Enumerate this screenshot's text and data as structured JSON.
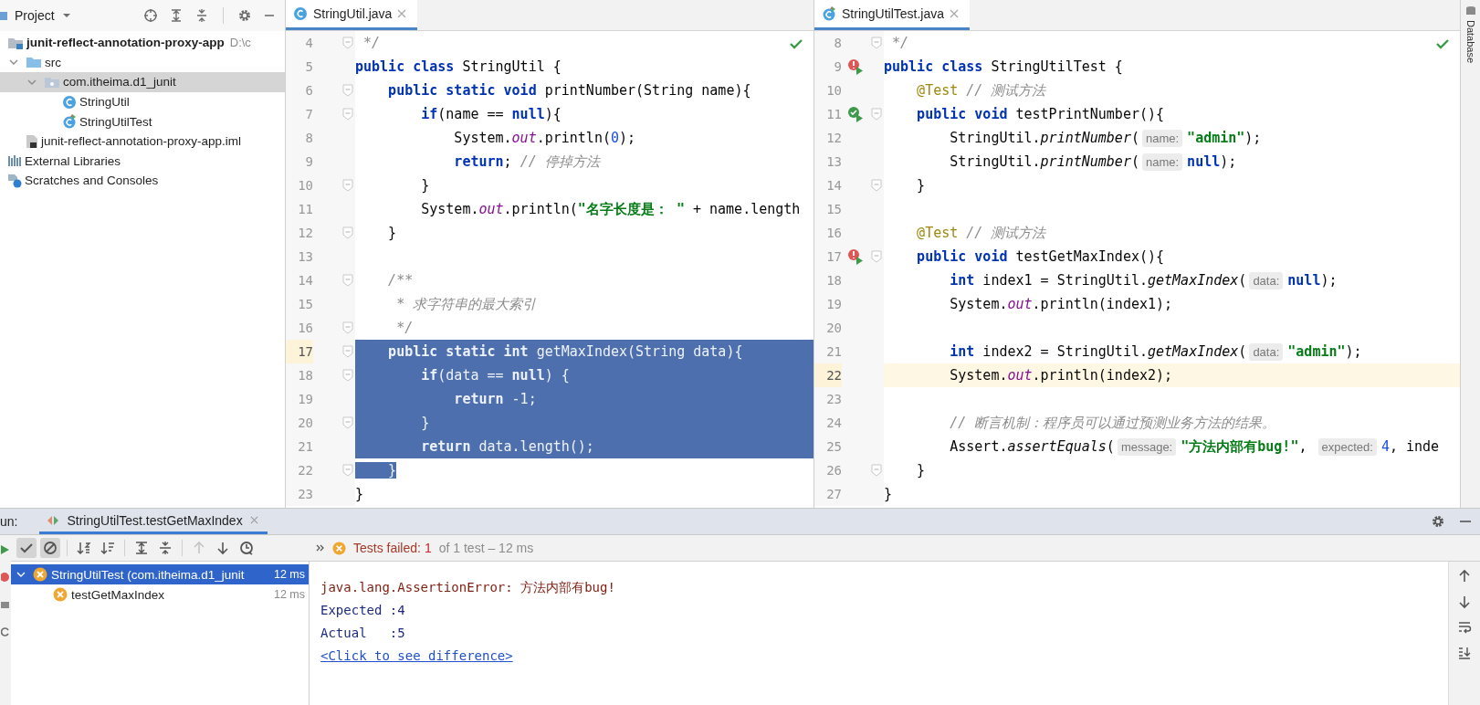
{
  "project": {
    "title": "Project",
    "tree": [
      {
        "label": "junit-reflect-annotation-proxy-app",
        "note": "D:\\c",
        "kind": "module",
        "selected": false,
        "children": [
          {
            "label": "src",
            "kind": "folder",
            "expanded": true,
            "selected": false,
            "children": [
              {
                "label": "com.itheima.d1_junit",
                "kind": "package",
                "expanded": true,
                "selected": true,
                "children": [
                  {
                    "label": "StringUtil",
                    "kind": "class",
                    "selected": false
                  },
                  {
                    "label": "StringUtilTest",
                    "kind": "test-class",
                    "selected": false
                  }
                ]
              }
            ]
          },
          {
            "label": "junit-reflect-annotation-proxy-app.iml",
            "kind": "file",
            "selected": false
          }
        ]
      },
      {
        "label": "External Libraries",
        "kind": "libraries",
        "selected": false
      },
      {
        "label": "Scratches and Consoles",
        "kind": "scratches",
        "selected": false
      }
    ]
  },
  "editors": [
    {
      "tab": {
        "title": "StringUtil.java",
        "kind": "class",
        "selected": true
      },
      "lines": [
        {
          "number": "4",
          "fold": true,
          "current": false,
          "tokens": [
            {
              "kind": "comment",
              "text": " */"
            }
          ]
        },
        {
          "number": "5",
          "fold": false,
          "current": false,
          "tokens": [
            {
              "kind": "keyword",
              "text": "public class "
            },
            {
              "kind": "plain",
              "text": "StringUtil {"
            }
          ]
        },
        {
          "number": "6",
          "fold": true,
          "current": false,
          "tokens": [
            {
              "kind": "keyword",
              "text": "    public static void "
            },
            {
              "kind": "plain",
              "text": "printNumber(String name){"
            }
          ]
        },
        {
          "number": "7",
          "fold": true,
          "current": false,
          "tokens": [
            {
              "kind": "keyword",
              "text": "        if"
            },
            {
              "kind": "plain",
              "text": "(name == "
            },
            {
              "kind": "keyword",
              "text": "null"
            },
            {
              "kind": "plain",
              "text": "){"
            }
          ]
        },
        {
          "number": "8",
          "fold": false,
          "current": false,
          "tokens": [
            {
              "kind": "plain",
              "text": "            System."
            },
            {
              "kind": "field",
              "text": "out"
            },
            {
              "kind": "plain",
              "text": ".println("
            },
            {
              "kind": "number",
              "text": "0"
            },
            {
              "kind": "plain",
              "text": ");"
            }
          ]
        },
        {
          "number": "9",
          "fold": false,
          "current": false,
          "tokens": [
            {
              "kind": "keyword",
              "text": "            return"
            },
            {
              "kind": "plain",
              "text": "; "
            },
            {
              "kind": "comment",
              "text": "// 停掉方法"
            }
          ]
        },
        {
          "number": "10",
          "fold": true,
          "current": false,
          "tokens": [
            {
              "kind": "plain",
              "text": "        }"
            }
          ]
        },
        {
          "number": "11",
          "fold": false,
          "current": false,
          "tokens": [
            {
              "kind": "plain",
              "text": "        System."
            },
            {
              "kind": "field",
              "text": "out"
            },
            {
              "kind": "plain",
              "text": ".println("
            },
            {
              "kind": "string",
              "text": "\"名字长度是： \""
            },
            {
              "kind": "plain",
              "text": " + name.length"
            }
          ]
        },
        {
          "number": "12",
          "fold": true,
          "current": false,
          "tokens": [
            {
              "kind": "plain",
              "text": "    }"
            }
          ]
        },
        {
          "number": "13",
          "fold": false,
          "current": false
        },
        {
          "number": "14",
          "fold": true,
          "current": false,
          "tokens": [
            {
              "kind": "comment",
              "text": "    /**"
            }
          ]
        },
        {
          "number": "15",
          "fold": false,
          "current": false,
          "tokens": [
            {
              "kind": "comment",
              "text": "     * 求字符串的最大索引"
            }
          ]
        },
        {
          "number": "16",
          "fold": true,
          "current": false,
          "tokens": [
            {
              "kind": "comment",
              "text": "     */"
            }
          ]
        },
        {
          "number": "17",
          "fold": true,
          "current": true,
          "selected": true,
          "tokens": [
            {
              "kind": "keyword",
              "text": "    public static int "
            },
            {
              "kind": "plain",
              "text": "getMaxIndex(String data){"
            }
          ]
        },
        {
          "number": "18",
          "fold": true,
          "current": false,
          "selected": true,
          "tokens": [
            {
              "kind": "keyword",
              "text": "        if"
            },
            {
              "kind": "plain",
              "text": "(data == "
            },
            {
              "kind": "keyword",
              "text": "null"
            },
            {
              "kind": "plain",
              "text": ") {"
            }
          ]
        },
        {
          "number": "19",
          "fold": false,
          "current": false,
          "selected": true,
          "tokens": [
            {
              "kind": "keyword",
              "text": "            return"
            },
            {
              "kind": "plain",
              "text": " -1;"
            }
          ]
        },
        {
          "number": "20",
          "fold": true,
          "current": false,
          "selected": true,
          "tokens": [
            {
              "kind": "plain",
              "text": "        }"
            }
          ]
        },
        {
          "number": "21",
          "fold": false,
          "current": false,
          "selected": true,
          "tokens": [
            {
              "kind": "keyword",
              "text": "        return"
            },
            {
              "kind": "plain",
              "text": " data.length();"
            }
          ]
        },
        {
          "number": "22",
          "fold": true,
          "current": false,
          "selected": false,
          "tokens": [
            {
              "kind": "plain",
              "text": "    }",
              "selected": true
            }
          ]
        },
        {
          "number": "23",
          "fold": false,
          "current": false,
          "tokens": [
            {
              "kind": "plain",
              "text": "}"
            }
          ]
        }
      ]
    },
    {
      "tab": {
        "title": "StringUtilTest.java",
        "kind": "test-class",
        "selected": true
      },
      "lines": [
        {
          "number": "8",
          "fold": true,
          "current": false,
          "tokens": [
            {
              "kind": "comment",
              "text": " */"
            }
          ]
        },
        {
          "number": "9",
          "fold": false,
          "current": false,
          "run": {
            "passed": false
          },
          "tokens": [
            {
              "kind": "keyword",
              "text": "public class "
            },
            {
              "kind": "plain",
              "text": "StringUtilTest {"
            }
          ]
        },
        {
          "number": "10",
          "fold": false,
          "current": false,
          "tokens": [
            {
              "kind": "annotation",
              "text": "    @Test"
            },
            {
              "kind": "comment",
              "text": " // 测试方法"
            }
          ]
        },
        {
          "number": "11",
          "fold": true,
          "current": false,
          "run": {
            "passed": true
          },
          "tokens": [
            {
              "kind": "keyword",
              "text": "    public void "
            },
            {
              "kind": "plain",
              "text": "testPrintNumber(){"
            }
          ]
        },
        {
          "number": "12",
          "fold": false,
          "current": false,
          "tokens": [
            {
              "kind": "plain",
              "text": "        StringUtil."
            },
            {
              "kind": "method",
              "text": "printNumber"
            },
            {
              "kind": "plain",
              "text": "("
            },
            {
              "kind": "hint",
              "text": "name:"
            },
            {
              "kind": "string",
              "text": "\"admin\""
            },
            {
              "kind": "plain",
              "text": ");"
            }
          ]
        },
        {
          "number": "13",
          "fold": false,
          "current": false,
          "tokens": [
            {
              "kind": "plain",
              "text": "        StringUtil."
            },
            {
              "kind": "method",
              "text": "printNumber"
            },
            {
              "kind": "plain",
              "text": "("
            },
            {
              "kind": "hint",
              "text": "name:"
            },
            {
              "kind": "keyword",
              "text": "null"
            },
            {
              "kind": "plain",
              "text": ");"
            }
          ]
        },
        {
          "number": "14",
          "fold": true,
          "current": false,
          "tokens": [
            {
              "kind": "plain",
              "text": "    }"
            }
          ]
        },
        {
          "number": "15",
          "fold": false,
          "current": false
        },
        {
          "number": "16",
          "fold": false,
          "current": false,
          "tokens": [
            {
              "kind": "annotation",
              "text": "    @Test"
            },
            {
              "kind": "comment",
              "text": " // 测试方法"
            }
          ]
        },
        {
          "number": "17",
          "fold": true,
          "current": false,
          "run": {
            "passed": false
          },
          "tokens": [
            {
              "kind": "keyword",
              "text": "    public void "
            },
            {
              "kind": "plain",
              "text": "testGetMaxIndex(){"
            }
          ]
        },
        {
          "number": "18",
          "fold": false,
          "current": false,
          "tokens": [
            {
              "kind": "keyword",
              "text": "        int"
            },
            {
              "kind": "plain",
              "text": " index1 = StringUtil."
            },
            {
              "kind": "method",
              "text": "getMaxIndex"
            },
            {
              "kind": "plain",
              "text": "("
            },
            {
              "kind": "hint",
              "text": "data:"
            },
            {
              "kind": "keyword",
              "text": "null"
            },
            {
              "kind": "plain",
              "text": ");"
            }
          ]
        },
        {
          "number": "19",
          "fold": false,
          "current": false,
          "tokens": [
            {
              "kind": "plain",
              "text": "        System."
            },
            {
              "kind": "field",
              "text": "out"
            },
            {
              "kind": "plain",
              "text": ".println(index1);"
            }
          ]
        },
        {
          "number": "20",
          "fold": false,
          "current": false
        },
        {
          "number": "21",
          "fold": false,
          "current": false,
          "tokens": [
            {
              "kind": "keyword",
              "text": "        int"
            },
            {
              "kind": "plain",
              "text": " index2 = StringUtil."
            },
            {
              "kind": "method",
              "text": "getMaxIndex"
            },
            {
              "kind": "plain",
              "text": "("
            },
            {
              "kind": "hint",
              "text": "data:"
            },
            {
              "kind": "string",
              "text": "\"admin\""
            },
            {
              "kind": "plain",
              "text": ");"
            }
          ]
        },
        {
          "number": "22",
          "fold": false,
          "current": true,
          "tokens": [
            {
              "kind": "plain",
              "text": "        System."
            },
            {
              "kind": "field",
              "text": "out"
            },
            {
              "kind": "plain",
              "text": ".println(index2);"
            }
          ]
        },
        {
          "number": "23",
          "fold": false,
          "current": false
        },
        {
          "number": "24",
          "fold": false,
          "current": false,
          "tokens": [
            {
              "kind": "comment",
              "text": "        // 断言机制：程序员可以通过预测业务方法的结果。"
            }
          ]
        },
        {
          "number": "25",
          "fold": false,
          "current": false,
          "tokens": [
            {
              "kind": "plain",
              "text": "        Assert."
            },
            {
              "kind": "method",
              "text": "assertEquals"
            },
            {
              "kind": "plain",
              "text": "("
            },
            {
              "kind": "hint",
              "text": "message:"
            },
            {
              "kind": "string",
              "text": "\"方法内部有bug!\""
            },
            {
              "kind": "plain",
              "text": ", "
            },
            {
              "kind": "hint",
              "text": "expected:"
            },
            {
              "kind": "number",
              "text": "4"
            },
            {
              "kind": "plain",
              "text": ", inde"
            }
          ]
        },
        {
          "number": "26",
          "fold": true,
          "current": false,
          "tokens": [
            {
              "kind": "plain",
              "text": "    }"
            }
          ]
        },
        {
          "number": "27",
          "fold": false,
          "current": false,
          "tokens": [
            {
              "kind": "plain",
              "text": "}"
            }
          ]
        }
      ]
    }
  ],
  "side_tab": {
    "label": "Database"
  },
  "run": {
    "label": "un:",
    "tab": {
      "title": "StringUtilTest.testGetMaxIndex",
      "selected": true
    },
    "toolbar_groups": [
      {
        "buttons": [
          {
            "kind": "show-passed",
            "on": true,
            "disabled": false
          },
          {
            "kind": "show-ignored",
            "on": true,
            "disabled": false
          }
        ]
      },
      {
        "buttons": [
          {
            "kind": "sort-alpha",
            "on": false,
            "disabled": false
          },
          {
            "kind": "sort-duration",
            "on": false,
            "disabled": false
          }
        ]
      },
      {
        "buttons": [
          {
            "kind": "expand-all",
            "on": false,
            "disabled": false
          },
          {
            "kind": "collapse-all",
            "on": false,
            "disabled": false
          }
        ]
      },
      {
        "buttons": [
          {
            "kind": "previous",
            "on": false,
            "disabled": true
          },
          {
            "kind": "next",
            "on": false,
            "disabled": false
          },
          {
            "kind": "history",
            "on": false,
            "disabled": false
          }
        ]
      }
    ],
    "status": {
      "label": "Tests failed:",
      "failed": "1",
      "rest": "of 1 test – 12 ms"
    },
    "tests": [
      {
        "label": "StringUtilTest (com.itheima.d1_junit",
        "time": "12 ms",
        "passed": false,
        "expanded": true,
        "selected": true,
        "children": [
          {
            "label": "testGetMaxIndex",
            "time": "12 ms",
            "passed": false,
            "selected": false
          }
        ]
      }
    ],
    "console": [
      {
        "kind": "error",
        "text": "java.lang.AssertionError: 方法内部有bug!"
      },
      {
        "kind": "output",
        "text": "Expected :4"
      },
      {
        "kind": "output",
        "text": "Actual   :5"
      },
      {
        "kind": "link",
        "text": "<Click to see difference>"
      }
    ]
  }
}
